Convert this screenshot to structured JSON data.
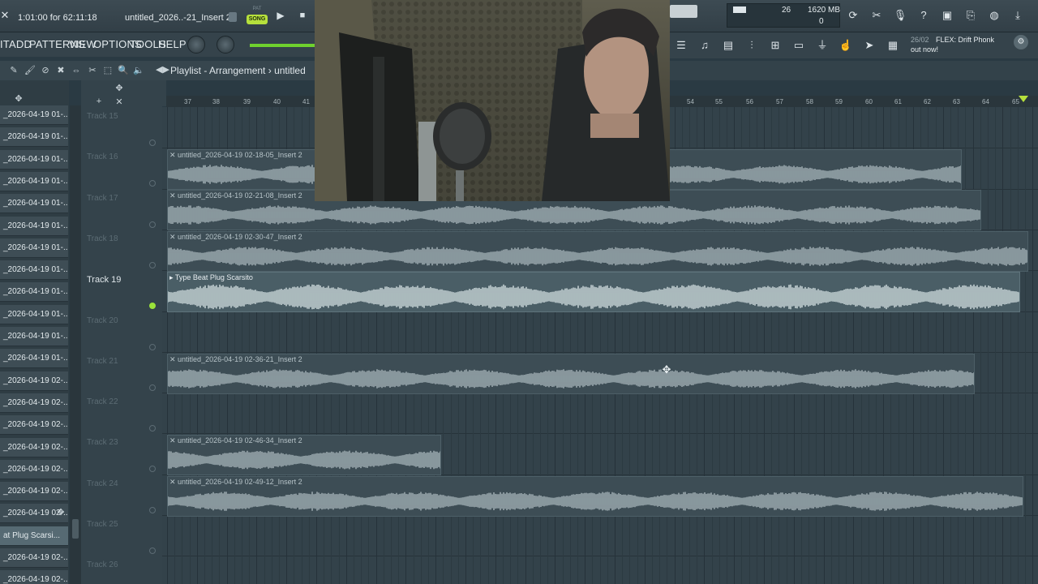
{
  "transport": {
    "time_readout": "1:01:00 for 62:11:18",
    "file_title": "untitled_2026..-21_Insert 2",
    "mode_pat": "PAT",
    "mode_song": "SONG",
    "cpu": "26",
    "memory": "1620 MB",
    "polyphony": "0"
  },
  "menu": {
    "items": [
      "IT",
      "ADD",
      "PATTERNS",
      "VIEW",
      "OPTIONS",
      "TOOLS",
      "HELP"
    ]
  },
  "news": {
    "date": "26/02",
    "text": "FLEX: Drift Phonk",
    "text2": "out now!"
  },
  "playlist": {
    "title": "Playlist - Arrangement",
    "breadcrumb_sep": "›",
    "project": "untitled"
  },
  "ruler": {
    "bars": [
      "37",
      "38",
      "39",
      "40",
      "41",
      "54",
      "55",
      "56",
      "57",
      "58",
      "59",
      "60",
      "61",
      "62",
      "63",
      "64",
      "65"
    ]
  },
  "picker": {
    "items": [
      "_2026-04-19 01-...",
      "_2026-04-19 01-...",
      "_2026-04-19 01-...",
      "_2026-04-19 01-...",
      "_2026-04-19 01-...",
      "_2026-04-19 01-...",
      "_2026-04-19 01-...",
      "_2026-04-19 01-...",
      "_2026-04-19 01-...",
      "_2026-04-19 01-...",
      "_2026-04-19 01-...",
      "_2026-04-19 01-...",
      "_2026-04-19 02-...",
      "_2026-04-19 02-...",
      "_2026-04-19 02-...",
      "_2026-04-19 02-...",
      "_2026-04-19 02-...",
      "_2026-04-19 02-...",
      "_2026-04-19 02-...",
      "at Plug Scarsi...",
      "_2026-04-19 02-...",
      "_2026-04-19 02-...",
      "_2026-04-19 02-..."
    ]
  },
  "tracks": [
    {
      "label": "Track 15"
    },
    {
      "label": "Track 16"
    },
    {
      "label": "Track 17"
    },
    {
      "label": "Track 18"
    },
    {
      "label": "Track 19"
    },
    {
      "label": "Track 20"
    },
    {
      "label": "Track 21"
    },
    {
      "label": "Track 22"
    },
    {
      "label": "Track 23"
    },
    {
      "label": "Track 24"
    },
    {
      "label": "Track 25"
    },
    {
      "label": "Track 26"
    }
  ],
  "clips": [
    {
      "name": "untitled_2026-04-19 02-18-05_Insert 2"
    },
    {
      "name": "untitled_2026-04-19 02-21-08_Insert 2"
    },
    {
      "name": "untitled_2026-04-19 02-30-47_Insert 2"
    },
    {
      "name": "Type Beat Plug Scarsito"
    },
    {
      "name": "untitled_2026-04-19 02-36-21_Insert 2"
    },
    {
      "name": "untitled_2026-04-19 02-46-34_Insert 2"
    },
    {
      "name": "untitled_2026-04-19 02-49-12_Insert 2"
    }
  ]
}
